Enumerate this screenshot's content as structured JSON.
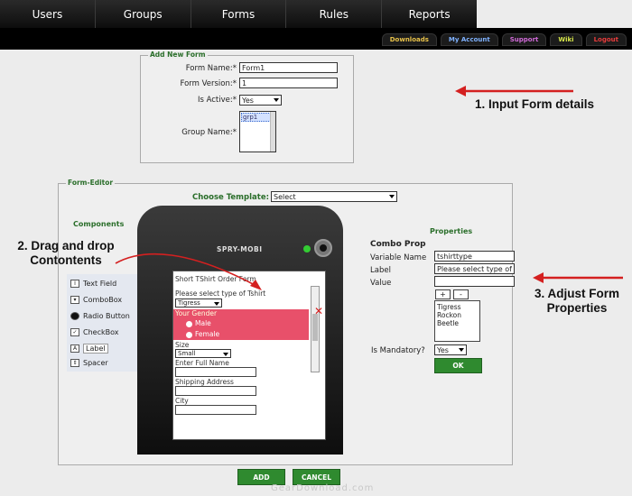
{
  "nav": {
    "tabs": [
      "Users",
      "Groups",
      "Forms",
      "Rules",
      "Reports"
    ]
  },
  "toplinks": [
    {
      "label": "Downloads",
      "color": "#e8c24a"
    },
    {
      "label": "My Account",
      "color": "#7fb2ff"
    },
    {
      "label": "Support",
      "color": "#d06ad8"
    },
    {
      "label": "Wiki",
      "color": "#d8e84a"
    },
    {
      "label": "Logout",
      "color": "#e83c3c"
    }
  ],
  "add_form": {
    "legend": "Add New Form",
    "form_name_label": "Form Name:*",
    "form_name_value": "Form1",
    "form_version_label": "Form Version:*",
    "form_version_value": "1",
    "is_active_label": "Is Active:*",
    "is_active_value": "Yes",
    "group_name_label": "Group Name:*",
    "group_selected": "grp1"
  },
  "editor": {
    "legend": "Form-Editor",
    "choose_template_label": "Choose Template:",
    "template_value": "Select",
    "components_title": "Components",
    "components": [
      "Text Field",
      "ComboBox",
      "Radio Button",
      "CheckBox",
      "Label",
      "Spacer"
    ],
    "phone_brand": "SPRY-MOBI",
    "screen": {
      "title": "Short TShirt Order Form",
      "q1": "Please select type of Tshirt",
      "q1_value": "Tigress",
      "gender_label": "Your Gender",
      "gender_opts": [
        "Male",
        "Female"
      ],
      "size_label": "Size",
      "size_value": "Small",
      "name_label": "Enter Full Name",
      "ship_label": "Shipping Address",
      "city_label": "City"
    },
    "properties_title": "Properties",
    "combo_prop": "Combo Prop",
    "var_name_label": "Variable Name",
    "var_name_value": "tshirttype",
    "label_label": "Label",
    "label_value": "Please select type of",
    "value_label": "Value",
    "plus": "+",
    "minus": "-",
    "values_list": [
      "Tigress",
      "Rockon",
      "Beetle"
    ],
    "mandatory_label": "Is Mandatory?",
    "mandatory_value": "Yes",
    "ok": "OK"
  },
  "buttons": {
    "add": "ADD",
    "cancel": "CANCEL"
  },
  "annotations": {
    "a1": "1. Input Form details",
    "a2_line1": "2. Drag and drop",
    "a2_line2": "Contontents",
    "a3_line1": "3. Adjust Form",
    "a3_line2": "Properties"
  },
  "watermark": "GearDownload.com"
}
